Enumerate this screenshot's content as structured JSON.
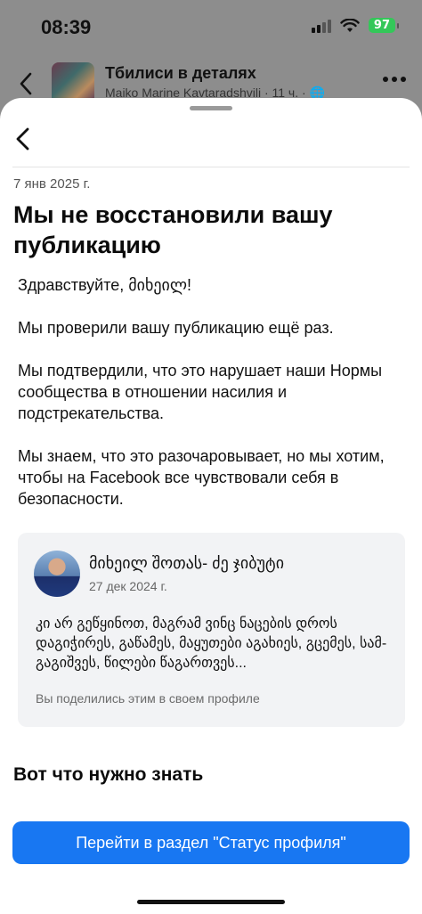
{
  "status_bar": {
    "time": "08:39",
    "battery": "97"
  },
  "background_header": {
    "title": "Тбилиси в деталях",
    "subtitle": "Maiko Marine Kavtaradshvili · 11 ч. · 🌐"
  },
  "sheet": {
    "date": "7 янв 2025 г.",
    "headline": "Мы не восстановили вашу публикацию",
    "paragraphs": [
      "Здравствуйте, მიხეილ!",
      "Мы проверили вашу публикацию ещё раз.",
      "Мы подтвердили, что это нарушает наши Нормы сообщества в отношении насилия и подстрекательства.",
      "Мы знаем, что это разочаровывает, но мы хотим, чтобы на Facebook все чувствовали себя в безопасности."
    ],
    "post": {
      "author": "მიხეილ შოთას- ძე ჯიბუტი",
      "date": "27 дек 2024 г.",
      "text": "კი არ გეწყინოთ, მაგრამ ვინც ნაცების დროს დაგიჭირეს, გაწამეს, მაყუთები აგახიეს, გცემეს, სამ- გაგიშვეს, წილები წაგართვეს...",
      "note": "Вы поделились этим в своем профиле"
    },
    "section_title": "Вот что нужно знать",
    "button_label": "Перейти в раздел \"Статус профиля\""
  },
  "colors": {
    "primary": "#1877f2",
    "battery": "#34c759",
    "card_bg": "#f2f3f5"
  }
}
